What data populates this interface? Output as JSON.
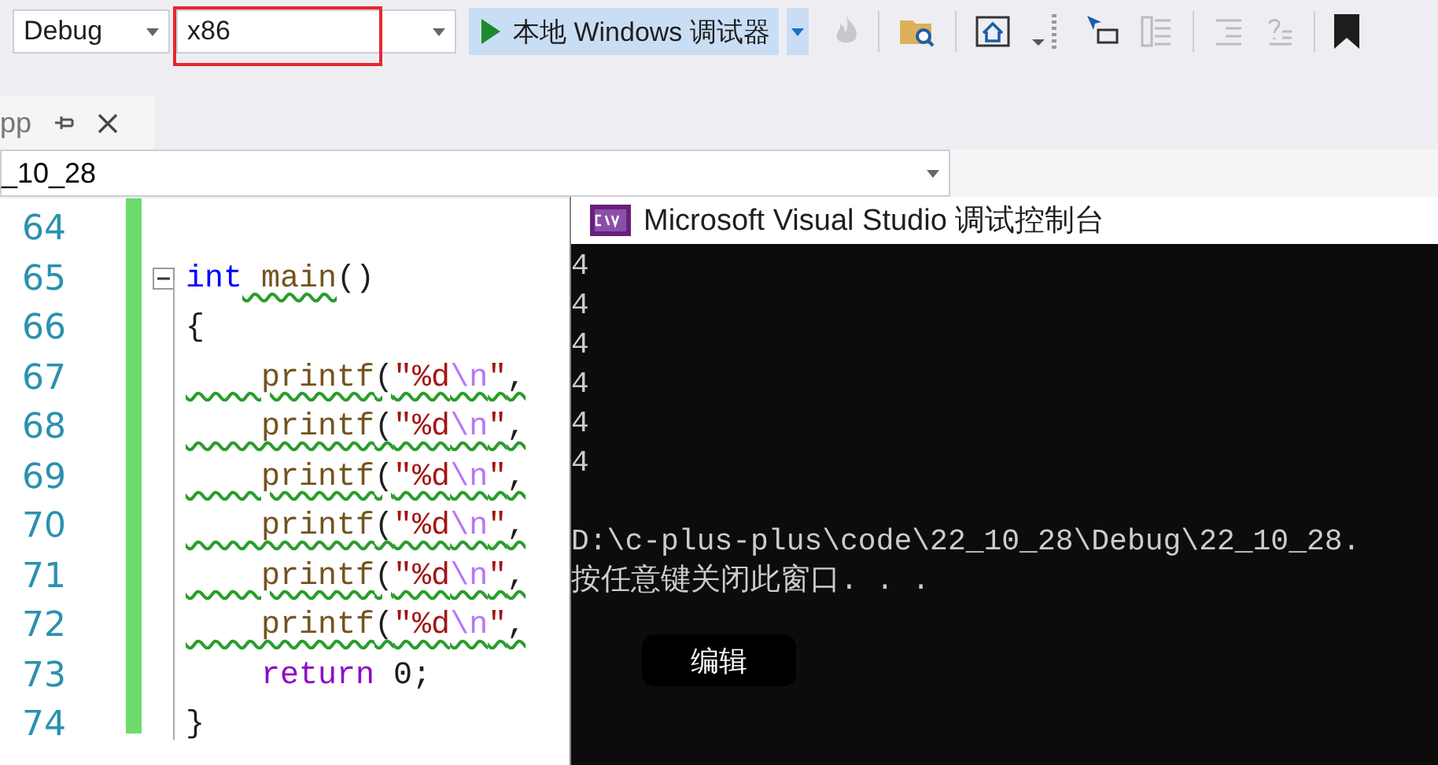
{
  "toolbar": {
    "configuration": {
      "value": "Debug"
    },
    "platform": {
      "value": "x86",
      "highlighted": true
    },
    "run_button": {
      "label": "本地 Windows 调试器"
    }
  },
  "tab": {
    "label": "pp",
    "selected": true
  },
  "nav_bar": {
    "project": "_10_28"
  },
  "editor": {
    "lines": [
      {
        "number": "64",
        "fold": false
      },
      {
        "number": "65",
        "fold": true,
        "segments": [
          {
            "kind": "keyword",
            "text": "int",
            "squiggle": false
          },
          {
            "kind": "function",
            "text": " main",
            "squiggle": true
          },
          {
            "kind": "plain",
            "text": "()",
            "squiggle": false
          }
        ]
      },
      {
        "number": "66",
        "fold": false,
        "segments": [
          {
            "kind": "plain",
            "text": "{",
            "squiggle": false
          }
        ]
      },
      {
        "number": "67",
        "fold": false,
        "segments": [
          {
            "kind": "function",
            "text": "    printf",
            "squiggle": true
          },
          {
            "kind": "plain",
            "text": "(",
            "squiggle": true
          },
          {
            "kind": "string",
            "text": "\"%d",
            "squiggle": true
          },
          {
            "kind": "escape",
            "text": "\\n",
            "squiggle": true
          },
          {
            "kind": "string",
            "text": "\"",
            "squiggle": true
          },
          {
            "kind": "plain",
            "text": ",",
            "squiggle": true
          }
        ]
      },
      {
        "number": "68",
        "fold": false,
        "segments": [
          {
            "kind": "function",
            "text": "    printf",
            "squiggle": true
          },
          {
            "kind": "plain",
            "text": "(",
            "squiggle": true
          },
          {
            "kind": "string",
            "text": "\"%d",
            "squiggle": true
          },
          {
            "kind": "escape",
            "text": "\\n",
            "squiggle": true
          },
          {
            "kind": "string",
            "text": "\"",
            "squiggle": true
          },
          {
            "kind": "plain",
            "text": ",",
            "squiggle": true
          }
        ]
      },
      {
        "number": "69",
        "fold": false,
        "segments": [
          {
            "kind": "function",
            "text": "    printf",
            "squiggle": true
          },
          {
            "kind": "plain",
            "text": "(",
            "squiggle": true
          },
          {
            "kind": "string",
            "text": "\"%d",
            "squiggle": true
          },
          {
            "kind": "escape",
            "text": "\\n",
            "squiggle": true
          },
          {
            "kind": "string",
            "text": "\"",
            "squiggle": true
          },
          {
            "kind": "plain",
            "text": ",",
            "squiggle": true
          }
        ]
      },
      {
        "number": "70",
        "fold": false,
        "segments": [
          {
            "kind": "function",
            "text": "    printf",
            "squiggle": true
          },
          {
            "kind": "plain",
            "text": "(",
            "squiggle": true
          },
          {
            "kind": "string",
            "text": "\"%d",
            "squiggle": true
          },
          {
            "kind": "escape",
            "text": "\\n",
            "squiggle": true
          },
          {
            "kind": "string",
            "text": "\"",
            "squiggle": true
          },
          {
            "kind": "plain",
            "text": ",",
            "squiggle": true
          }
        ]
      },
      {
        "number": "71",
        "fold": false,
        "segments": [
          {
            "kind": "function",
            "text": "    printf",
            "squiggle": true
          },
          {
            "kind": "plain",
            "text": "(",
            "squiggle": true
          },
          {
            "kind": "string",
            "text": "\"%d",
            "squiggle": true
          },
          {
            "kind": "escape",
            "text": "\\n",
            "squiggle": true
          },
          {
            "kind": "string",
            "text": "\"",
            "squiggle": true
          },
          {
            "kind": "plain",
            "text": ",",
            "squiggle": true
          }
        ]
      },
      {
        "number": "72",
        "fold": false,
        "segments": [
          {
            "kind": "function",
            "text": "    printf",
            "squiggle": true
          },
          {
            "kind": "plain",
            "text": "(",
            "squiggle": true
          },
          {
            "kind": "string",
            "text": "\"%d",
            "squiggle": true
          },
          {
            "kind": "escape",
            "text": "\\n",
            "squiggle": true
          },
          {
            "kind": "string",
            "text": "\"",
            "squiggle": true
          },
          {
            "kind": "plain",
            "text": ",",
            "squiggle": true
          }
        ]
      },
      {
        "number": "73",
        "fold": false,
        "segments": [
          {
            "kind": "control",
            "text": "    return",
            "squiggle": false
          },
          {
            "kind": "plain",
            "text": " 0;",
            "squiggle": false
          }
        ]
      },
      {
        "number": "74",
        "fold": false,
        "segments": [
          {
            "kind": "plain",
            "text": "}",
            "squiggle": false
          }
        ]
      }
    ]
  },
  "console": {
    "title": "Microsoft Visual Studio 调试控制台",
    "output_lines": [
      "4",
      "4",
      "4",
      "4",
      "4",
      "4"
    ],
    "message_lines": [
      "D:\\c-plus-plus\\code\\22_10_28\\Debug\\22_10_28.",
      "按任意键关闭此窗口. . ."
    ],
    "edit_button": {
      "label": "编辑"
    }
  }
}
